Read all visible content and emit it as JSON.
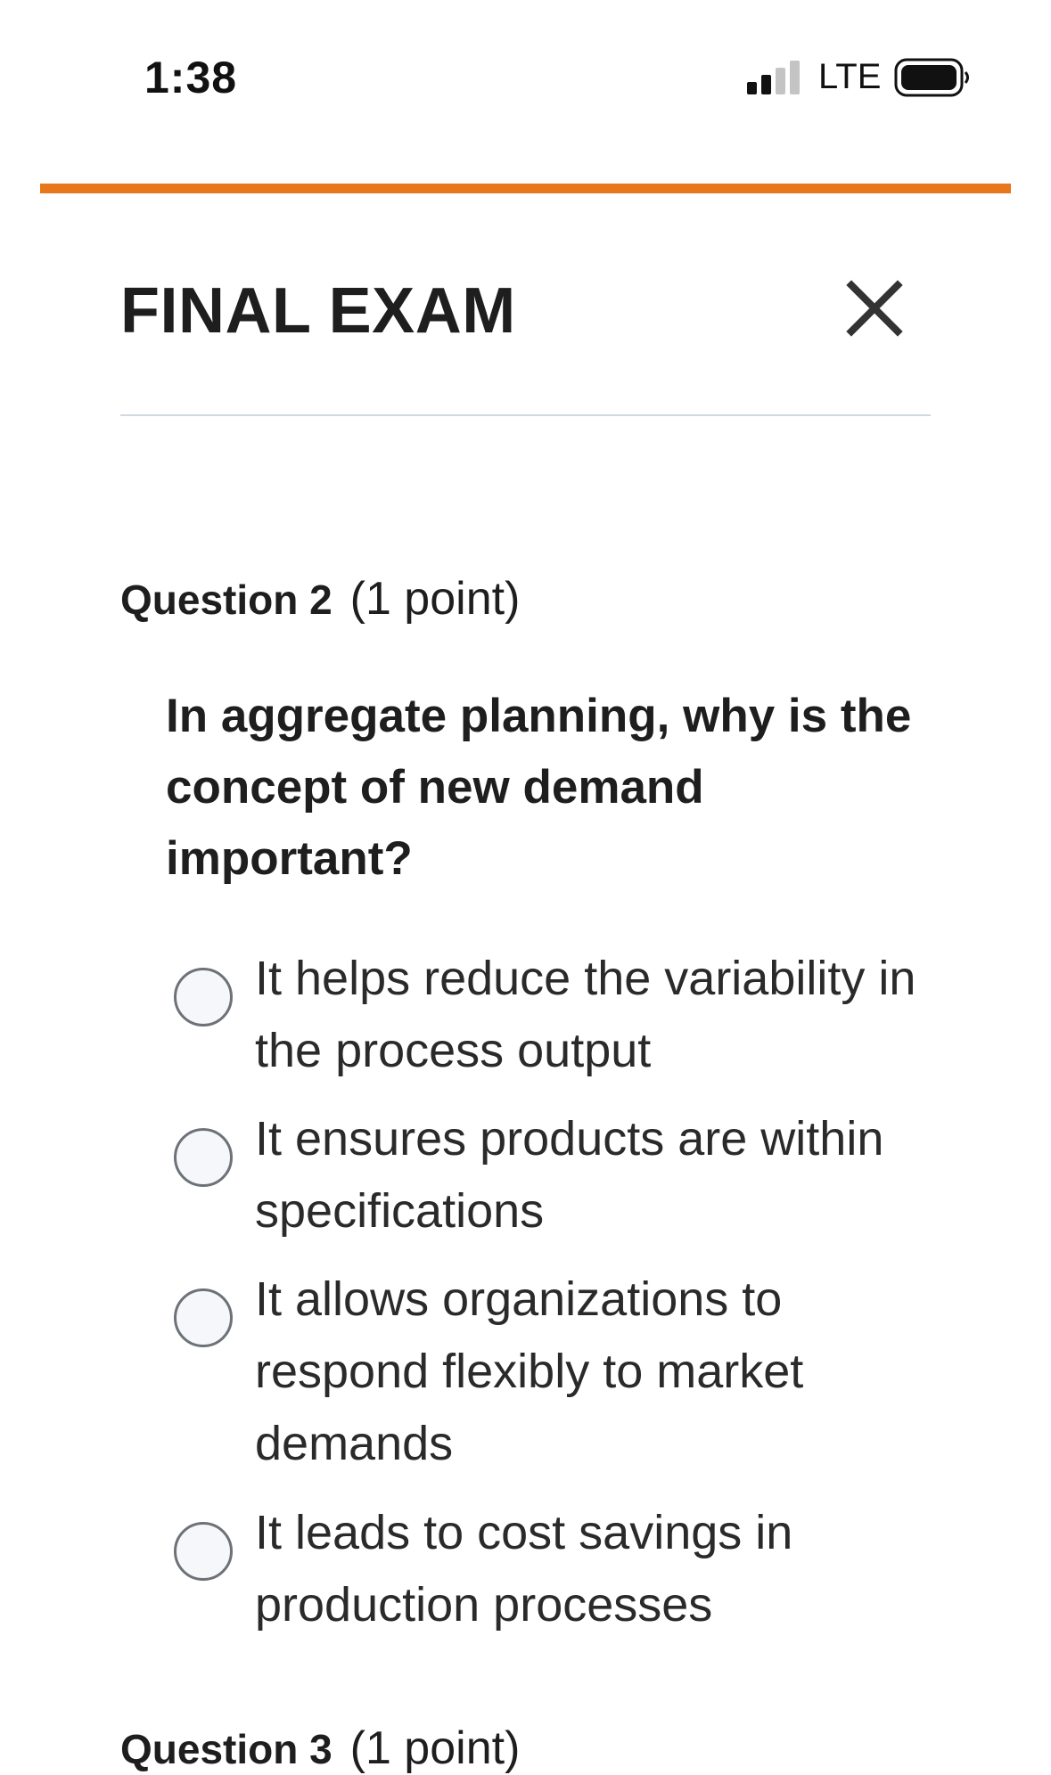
{
  "status_bar": {
    "time": "1:38",
    "network": "LTE",
    "signal_icon": "cellular-signal-icon",
    "battery_icon": "battery-icon"
  },
  "colors": {
    "accent": "#e8761a",
    "divider": "#cfd8e0",
    "text": "#1e1e1e",
    "radio_border": "#6d7278",
    "radio_fill": "#f5f7fb"
  },
  "header": {
    "title": "FINAL EXAM",
    "close_icon": "close-icon"
  },
  "question": {
    "number_label": "Question 2",
    "points_label": "(1 point)",
    "text": "In aggregate planning, why is the concept of new demand important?",
    "options": [
      {
        "label": "It helps reduce the variability in the process output",
        "selected": false
      },
      {
        "label": "It ensures products are within specifications",
        "selected": false
      },
      {
        "label": "It allows organizations to respond flexibly to market demands",
        "selected": false
      },
      {
        "label": "It leads to cost savings in production processes",
        "selected": false
      }
    ]
  },
  "next_question": {
    "number_label": "Question 3",
    "points_label": "(1 point)"
  }
}
